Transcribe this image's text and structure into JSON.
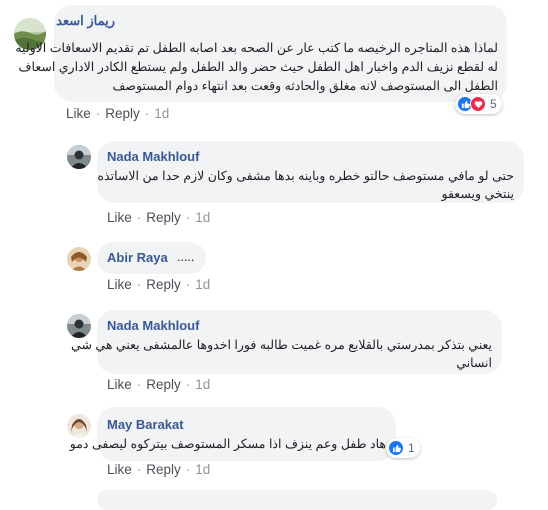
{
  "comments": [
    {
      "author": "ريماز اسعد",
      "lines": [
        "لماذا هذه المتاجره الرخيصه ما كتب عار عن الصحه بعد اصابه الطفل تم تقديم الاسعافات الاوليه",
        "له لقطع نزيف الدم واخبار اهل الطفل حيث حضر والد الطفل ولم يستطع الكادر الاداري اسعاف",
        "الطفل الى المستوصف لانه مغلق والحادثه وقعت بعد انتهاء دوام المستوصف"
      ],
      "actions": {
        "like": "Like",
        "reply": "Reply",
        "time": "1d"
      },
      "reactions": {
        "count": "5",
        "icons": [
          "like-icon",
          "love-icon"
        ]
      }
    },
    {
      "author": "Nada Makhlouf",
      "lines": [
        "حتى لو مافي مستوصف حالتو خطره وباينه بدها مشفى وكان لازم حدا من الاساتذه",
        "ينتخي ويسعفو"
      ],
      "actions": {
        "like": "Like",
        "reply": "Reply",
        "time": "1d"
      }
    },
    {
      "author": "Abir Raya",
      "inline_text": ".....",
      "actions": {
        "like": "Like",
        "reply": "Reply",
        "time": "1d"
      }
    },
    {
      "author": "Nada Makhlouf",
      "lines": [
        "يعني بتذكر بمدرستي بالقلايع مره غميت طالبه فورا اخدوها عالمشفى يعني هي شي",
        "انساني"
      ],
      "actions": {
        "like": "Like",
        "reply": "Reply",
        "time": "1d"
      }
    },
    {
      "author": "May Barakat",
      "lines": [
        "هاد طفل وعم ينزف اذا مسكر المستوصف بيتركوه ليصفى دمو"
      ],
      "actions": {
        "like": "Like",
        "reply": "Reply",
        "time": "1d"
      },
      "reactions": {
        "count": "1",
        "icons": [
          "like-icon"
        ]
      }
    }
  ],
  "colors": {
    "bubble": "#f2f3f5",
    "author": "#385898",
    "like_blue": "#1877f2",
    "love_red": "#f0284a"
  }
}
